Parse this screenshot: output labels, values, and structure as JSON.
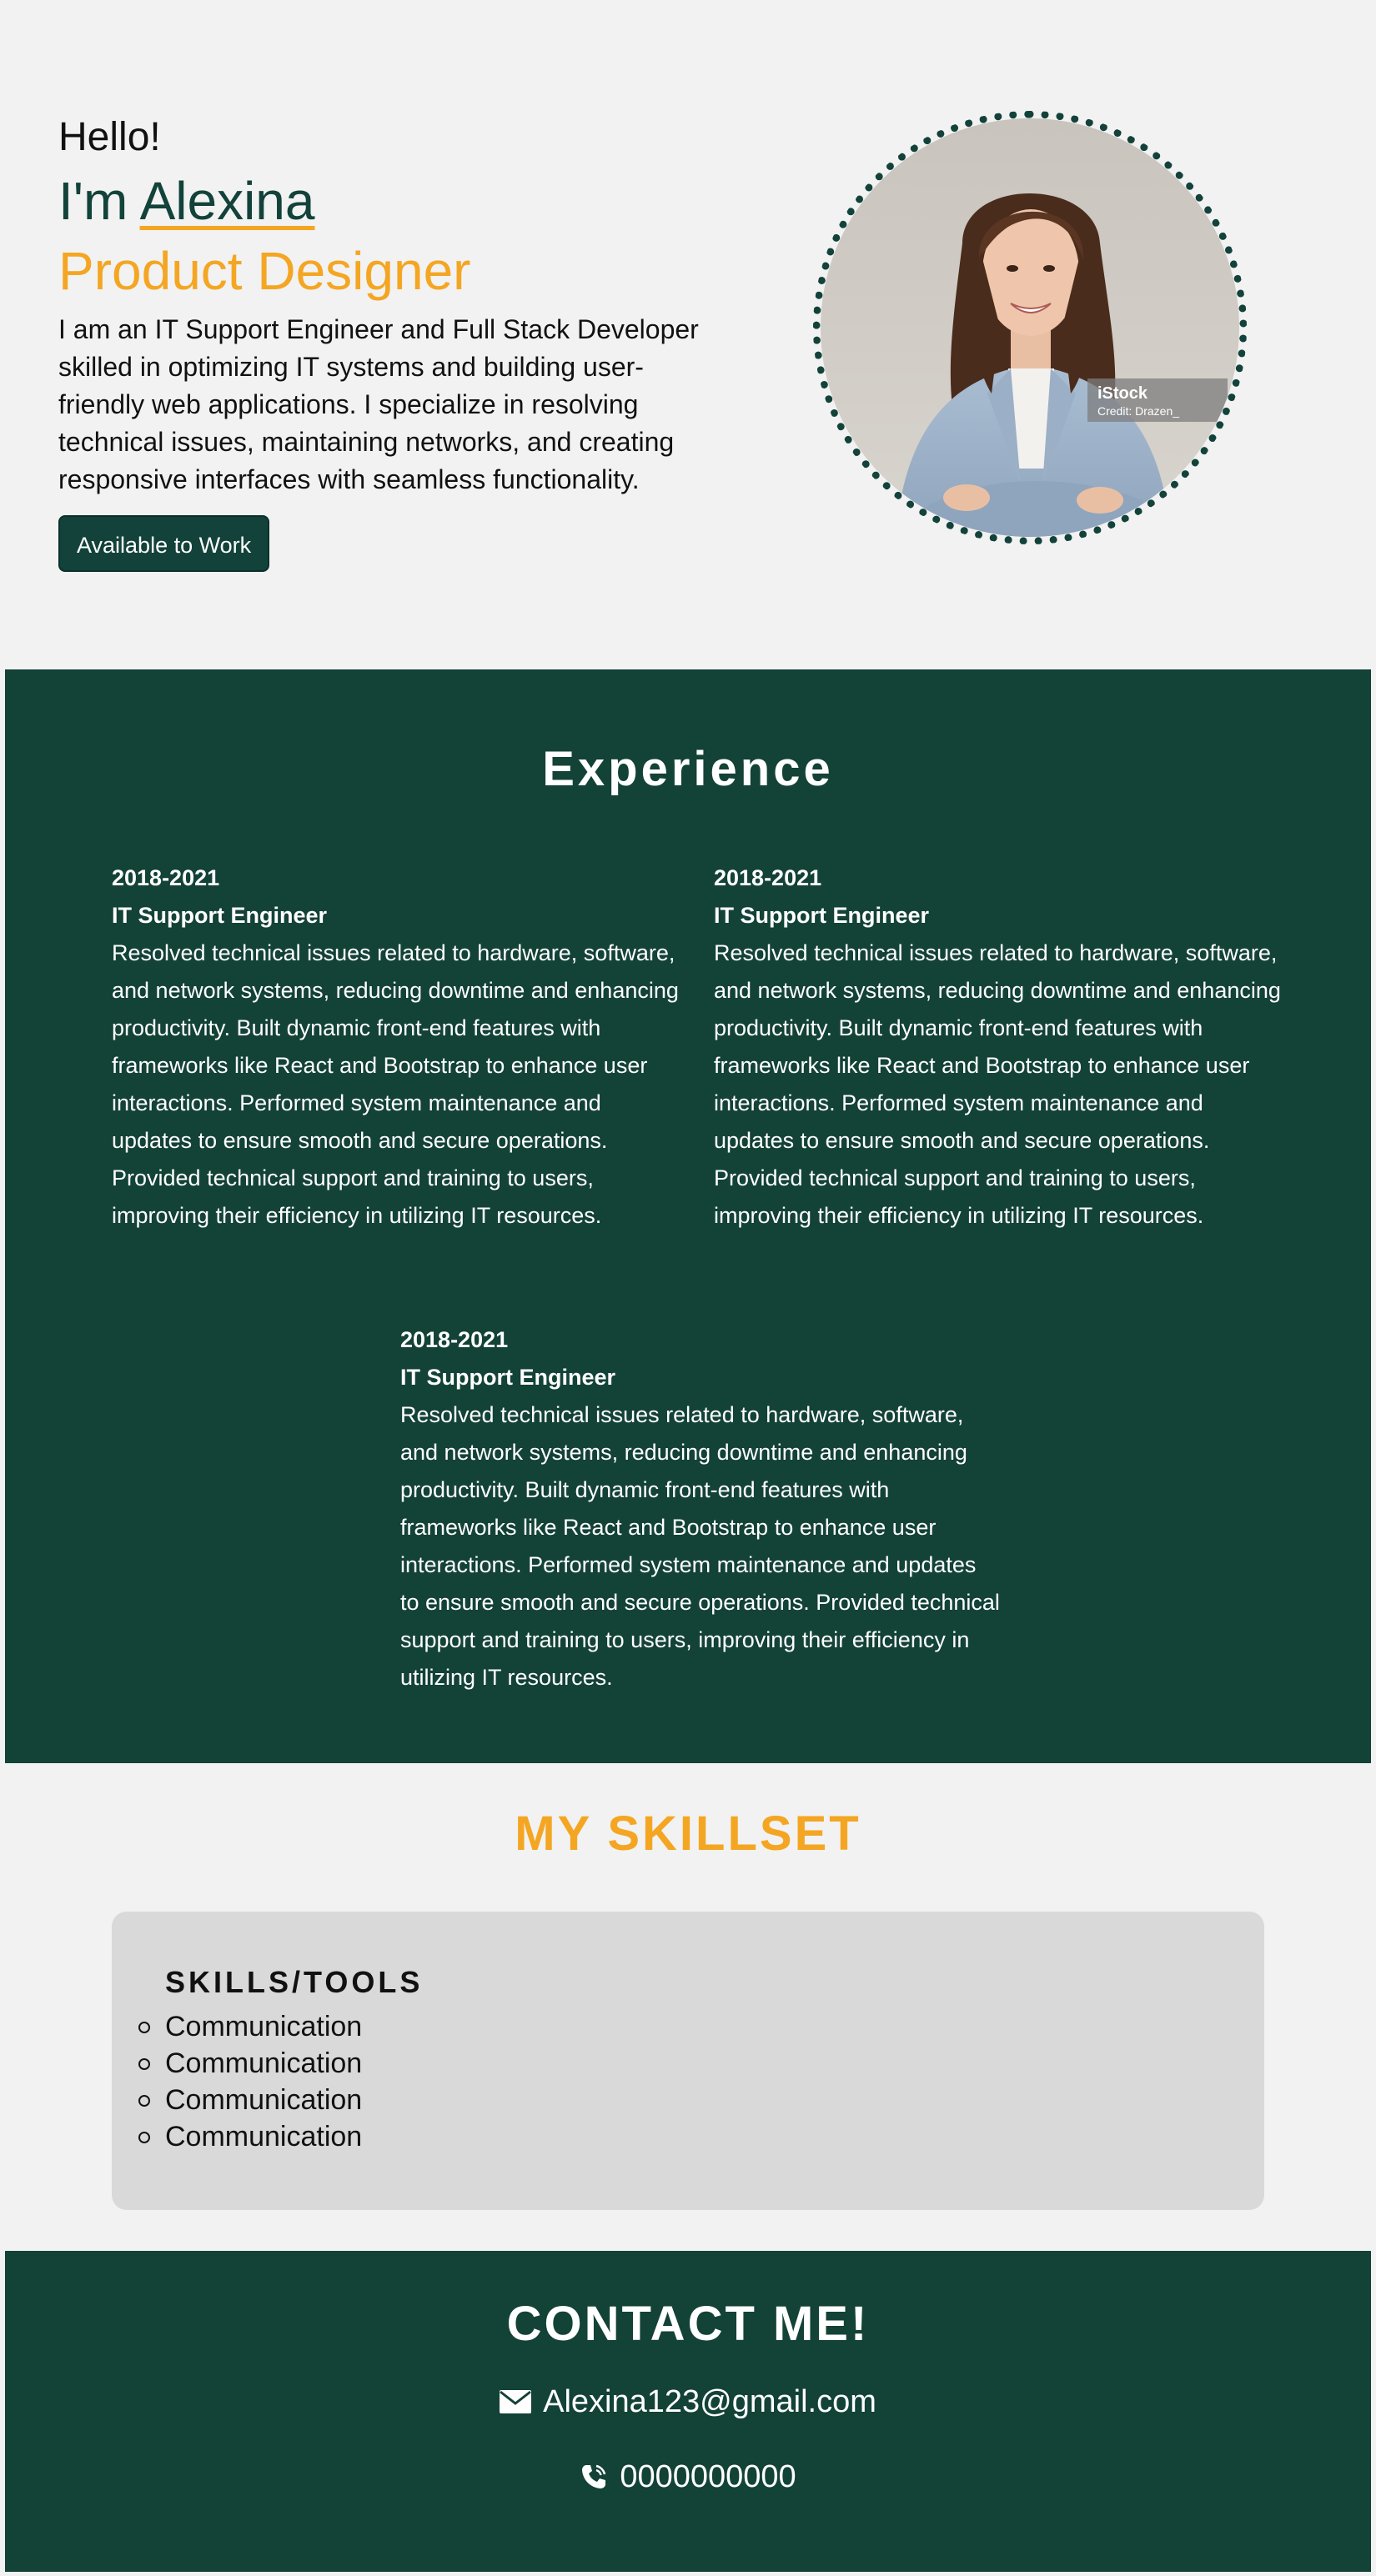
{
  "hero": {
    "greeting": "Hello!",
    "im_prefix": "I'm ",
    "name": "Alexina",
    "role": "Product Designer",
    "intro": "I am an IT Support Engineer and Full Stack Developer skilled in optimizing IT systems and building user-friendly web applications. I specialize in resolving technical issues, maintaining networks, and creating responsive interfaces with seamless functionality.",
    "status_button": "Available to Work",
    "photo_watermark": {
      "brand": "iStock",
      "credit": "Credit: Drazen_"
    }
  },
  "experience": {
    "title": "Experience",
    "jobs": [
      {
        "years": "2018-2021",
        "title": "IT Support Engineer",
        "description": "Resolved technical issues related to hardware, software, and network systems, reducing downtime and enhancing productivity. Built dynamic front-end features with frameworks like React and Bootstrap to enhance user interactions. Performed system maintenance and updates to ensure smooth and secure operations. Provided technical support and training to users, improving their efficiency in utilizing IT resources."
      },
      {
        "years": "2018-2021",
        "title": "IT Support Engineer",
        "description": "Resolved technical issues related to hardware, software, and network systems, reducing downtime and enhancing productivity. Built dynamic front-end features with frameworks like React and Bootstrap to enhance user interactions. Performed system maintenance and updates to ensure smooth and secure operations. Provided technical support and training to users, improving their efficiency in utilizing IT resources."
      },
      {
        "years": "2018-2021",
        "title": "IT Support Engineer",
        "description": "Resolved technical issues related to hardware, software, and network systems, reducing downtime and enhancing productivity. Built dynamic front-end features with frameworks like React and Bootstrap to enhance user interactions. Performed system maintenance and updates to ensure smooth and secure operations. Provided technical support and training to users, improving their efficiency in utilizing IT resources."
      }
    ]
  },
  "skills": {
    "title": "MY SKILLSET",
    "card_heading": "SKILLS/TOOLS",
    "items": [
      "Communication",
      "Communication",
      "Communication",
      "Communication"
    ]
  },
  "contact": {
    "title": "CONTACT ME!",
    "email": "Alexina123@gmail.com",
    "phone": "0000000000",
    "email_icon": "envelope-icon",
    "phone_icon": "phone-icon"
  },
  "colors": {
    "primary_green": "#134237",
    "accent_orange": "#f4a623",
    "page_background": "#f2f2f2",
    "card_background": "#d9d9d9"
  }
}
